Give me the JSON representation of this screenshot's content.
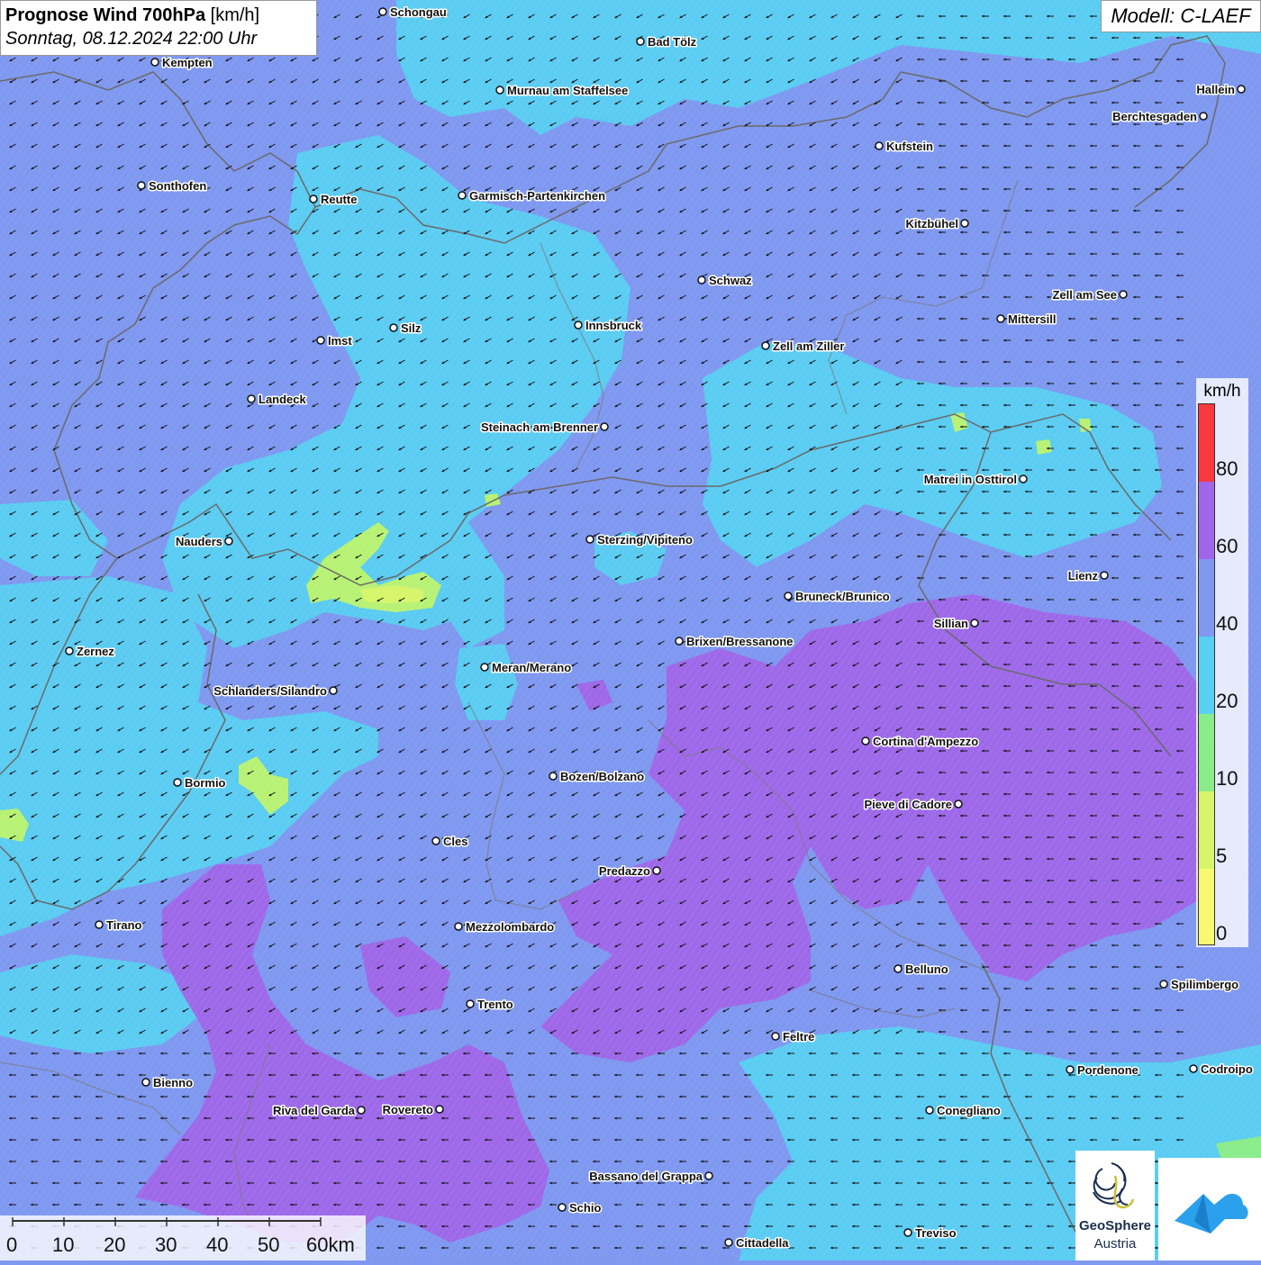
{
  "title": {
    "main": "Prognose Wind 700hPa",
    "unit": "[km/h]",
    "datetime": "Sonntag, 08.12.2024 22:00 Uhr"
  },
  "model": "Modell: C-LAEF",
  "legend": {
    "unit": "km/h",
    "ticks": [
      "80",
      "60",
      "40",
      "20",
      "10",
      "5",
      "0"
    ],
    "colors": {
      "c0": "#f9f871",
      "c5": "#d6f56a",
      "c10": "#8aec8a",
      "c20": "#58d0f2",
      "c40": "#7f98f0",
      "c60": "#a066e8",
      "c80": "#f83a3e"
    }
  },
  "scale": {
    "labels": [
      "0",
      "10",
      "20",
      "30",
      "40",
      "50",
      "60km"
    ]
  },
  "logo": {
    "name": "GeoSphere",
    "country": "Austria"
  },
  "cities": [
    {
      "name": "Schongau"
    },
    {
      "name": "Bad Tölz"
    },
    {
      "name": "Kempten"
    },
    {
      "name": "Murnau am Staffelsee"
    },
    {
      "name": "Hallein"
    },
    {
      "name": "Berchtesgaden"
    },
    {
      "name": "Kufstein"
    },
    {
      "name": "Sonthofen"
    },
    {
      "name": "Reutte"
    },
    {
      "name": "Garmisch-Partenkirchen"
    },
    {
      "name": "Kitzbühel"
    },
    {
      "name": "Schwaz"
    },
    {
      "name": "Zell am See"
    },
    {
      "name": "Mittersill"
    },
    {
      "name": "Innsbruck"
    },
    {
      "name": "Silz"
    },
    {
      "name": "Imst"
    },
    {
      "name": "Zell am Ziller"
    },
    {
      "name": "Landeck"
    },
    {
      "name": "Steinach am Brenner"
    },
    {
      "name": "Matrei in Osttirol"
    },
    {
      "name": "Nauders"
    },
    {
      "name": "Sterzing/Vipiteno"
    },
    {
      "name": "Lienz"
    },
    {
      "name": "Bruneck/Brunico"
    },
    {
      "name": "Sillian"
    },
    {
      "name": "Brixen/Bressanone"
    },
    {
      "name": "Zernez"
    },
    {
      "name": "Meran/Merano"
    },
    {
      "name": "Schlanders/Silandro"
    },
    {
      "name": "Cortina d'Ampezzo"
    },
    {
      "name": "Bozen/Bolzano"
    },
    {
      "name": "Bormio"
    },
    {
      "name": "Pieve di Cadore"
    },
    {
      "name": "Cles"
    },
    {
      "name": "Predazzo"
    },
    {
      "name": "Tirano"
    },
    {
      "name": "Mezzolombardo"
    },
    {
      "name": "Belluno"
    },
    {
      "name": "Spilimbergo"
    },
    {
      "name": "Trento"
    },
    {
      "name": "Feltre"
    },
    {
      "name": "Pordenone"
    },
    {
      "name": "Codroipo"
    },
    {
      "name": "Bienno"
    },
    {
      "name": "Riva del Garda"
    },
    {
      "name": "Rovereto"
    },
    {
      "name": "Conegliano"
    },
    {
      "name": "Bassano del Grappa"
    },
    {
      "name": "Schio"
    },
    {
      "name": "Treviso"
    },
    {
      "name": "Cittadella"
    }
  ]
}
